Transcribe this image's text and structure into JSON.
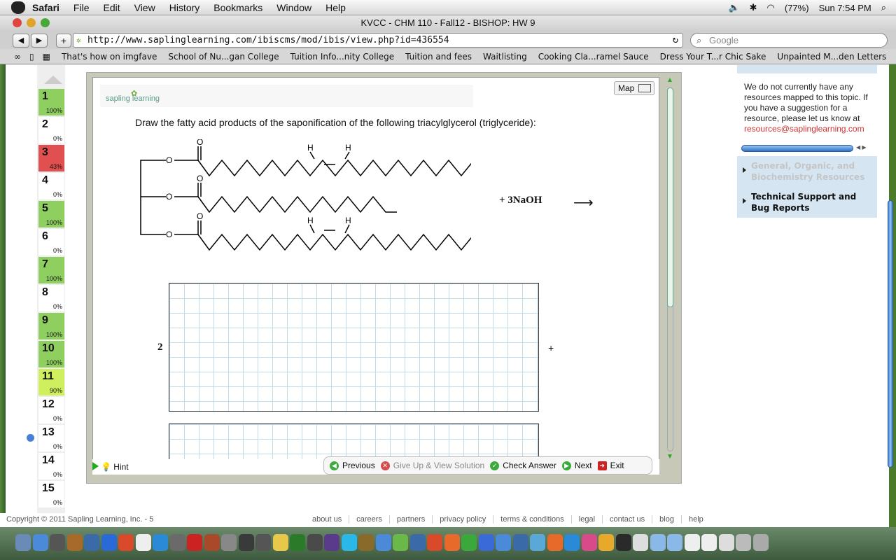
{
  "menubar": {
    "app": "Safari",
    "items": [
      "File",
      "Edit",
      "View",
      "History",
      "Bookmarks",
      "Window",
      "Help"
    ],
    "battery": "(77%)",
    "clock": "Sun 7:54 PM"
  },
  "window": {
    "title": "KVCC - CHM 110 - Fall12 - BISHOP: HW 9"
  },
  "toolbar": {
    "url": "http://www.saplinglearning.com/ibiscms/mod/ibis/view.php?id=436554",
    "search_placeholder": "Google",
    "back": "◀",
    "forward": "▶",
    "add": "+"
  },
  "bookmarks": [
    "That's how on imgfave",
    "School of Nu...gan College",
    "Tuition Info...nity College",
    "Tuition and fees",
    "Waitlisting",
    "Cooking Cla...ramel Sauce",
    "Dress Your T...r Chic Sake",
    "Unpainted M...den Letters"
  ],
  "questions": [
    {
      "num": "1",
      "pct": "100%",
      "color": "#8fcf5f"
    },
    {
      "num": "2",
      "pct": "0%",
      "color": "#ffffff"
    },
    {
      "num": "3",
      "pct": "43%",
      "color": "#e05050"
    },
    {
      "num": "4",
      "pct": "0%",
      "color": "#ffffff"
    },
    {
      "num": "5",
      "pct": "100%",
      "color": "#8fcf5f"
    },
    {
      "num": "6",
      "pct": "0%",
      "color": "#ffffff"
    },
    {
      "num": "7",
      "pct": "100%",
      "color": "#8fcf5f"
    },
    {
      "num": "8",
      "pct": "0%",
      "color": "#ffffff"
    },
    {
      "num": "9",
      "pct": "100%",
      "color": "#8fcf5f"
    },
    {
      "num": "10",
      "pct": "100%",
      "color": "#8fcf5f"
    },
    {
      "num": "11",
      "pct": "90%",
      "color": "#cfef5f"
    },
    {
      "num": "12",
      "pct": "0%",
      "color": "#ffffff"
    },
    {
      "num": "13",
      "pct": "0%",
      "color": "#ffffff"
    },
    {
      "num": "14",
      "pct": "0%",
      "color": "#ffffff"
    },
    {
      "num": "15",
      "pct": "0%",
      "color": "#ffffff"
    }
  ],
  "main": {
    "logo": "sapling learning",
    "map_label": "Map",
    "prompt": "Draw the fatty acid products of the saponification of the following triacylglycerol (triglyceride):",
    "molecule_labels": {
      "o": "O",
      "h": "H"
    },
    "reagent": "+ 3NaOH",
    "arrow": "⟶",
    "coefficient": "2",
    "plus": "+",
    "hint": "Hint"
  },
  "actions": [
    "Previous",
    "Give Up & View Solution",
    "Check Answer",
    "Next",
    "Exit"
  ],
  "sidebar": {
    "no_resources": "We do not currently have any resources mapped to this topic. If you have a suggestion for a resource, please let us know at",
    "email": "resources@saplinglearning.com",
    "items": [
      "General, Organic, and Biochemistry Resources",
      "Technical Support and Bug Reports"
    ]
  },
  "footer": {
    "copyright": "Copyright © 2011 Sapling Learning, Inc. - 5",
    "links": [
      "about us",
      "careers",
      "partners",
      "privacy policy",
      "terms & conditions",
      "legal",
      "contact us",
      "blog",
      "help"
    ]
  },
  "colors": {
    "accent_green": "#2a9a2a",
    "grid_line": "#c3dbe9",
    "link_red": "#c33333"
  }
}
